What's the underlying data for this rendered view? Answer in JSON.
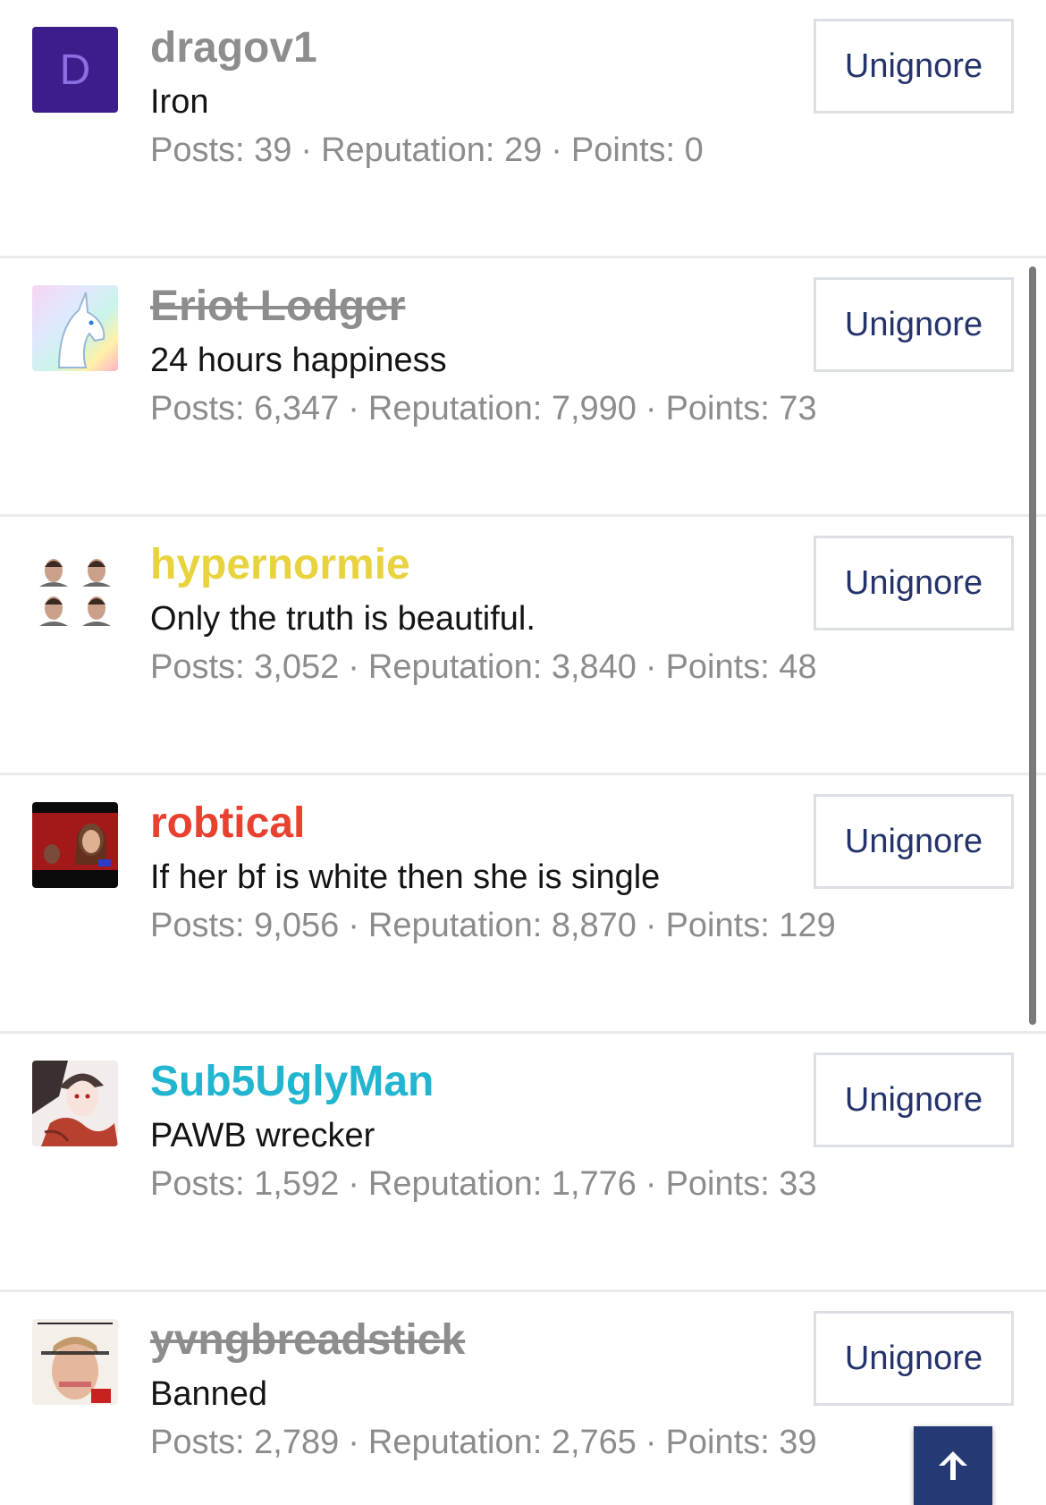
{
  "users": [
    {
      "username": "dragov1",
      "name_color": "#8d8d8d",
      "struck": false,
      "avatar": "letter-avatar",
      "avatar_letter": "D",
      "title": "Iron",
      "stats": {
        "posts_label": "Posts: 39",
        "reputation_label": "Reputation: 29",
        "points_label": "Points: 0"
      },
      "button_label": "Unignore"
    },
    {
      "username": "Eriot Lodger",
      "name_color": "#8d8d8d",
      "struck": true,
      "avatar": "unicorn-avatar",
      "title": "24 hours happiness",
      "stats": {
        "posts_label": "Posts: 6,347",
        "reputation_label": "Reputation: 7,990",
        "points_label": "Points: 73"
      },
      "button_label": "Unignore"
    },
    {
      "username": "hypernormie",
      "name_color": "#e8d33f",
      "struck": false,
      "avatar": "faces-grid-avatar",
      "title": "Only the truth is beautiful.",
      "stats": {
        "posts_label": "Posts: 3,052",
        "reputation_label": "Reputation: 3,840",
        "points_label": "Points: 48"
      },
      "button_label": "Unignore"
    },
    {
      "username": "robtical",
      "name_color": "#e8412f",
      "struck": false,
      "avatar": "photo-avatar",
      "title": "If her bf is white then she is single",
      "stats": {
        "posts_label": "Posts: 9,056",
        "reputation_label": "Reputation: 8,870",
        "points_label": "Points: 129"
      },
      "button_label": "Unignore"
    },
    {
      "username": "Sub5UglyMan",
      "name_color": "#21b5d0",
      "struck": false,
      "avatar": "anime-art-avatar",
      "title": "PAWB wrecker",
      "stats": {
        "posts_label": "Posts: 1,592",
        "reputation_label": "Reputation: 1,776",
        "points_label": "Points: 33"
      },
      "button_label": "Unignore"
    },
    {
      "username": "yvngbreadstick",
      "name_color": "#8d8d8d",
      "struck": true,
      "avatar": "magazine-cover-avatar",
      "title": "Banned",
      "stats": {
        "posts_label": "Posts: 2,789",
        "reputation_label": "Reputation: 2,765",
        "points_label": "Points: 39"
      },
      "button_label": "Unignore"
    }
  ],
  "scroll_top_icon": "arrow-up-icon"
}
